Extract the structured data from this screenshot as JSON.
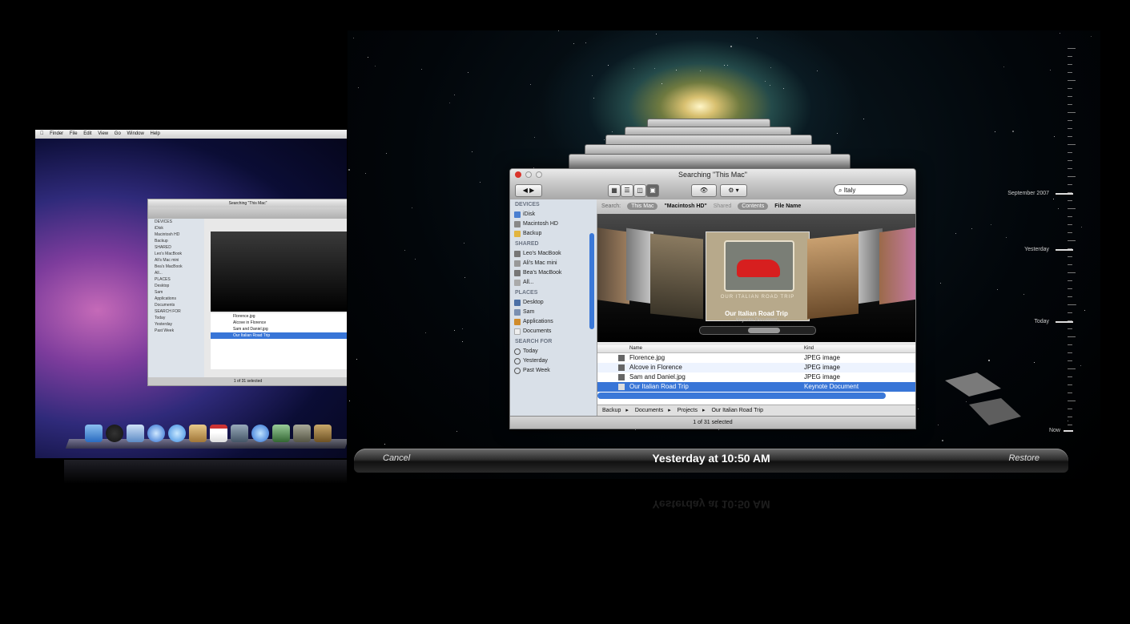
{
  "left_desktop": {
    "menubar": [
      "Finder",
      "File",
      "Edit",
      "View",
      "Go",
      "Window",
      "Help"
    ],
    "window_title": "Searching \"This Mac\"",
    "sidebar": [
      "DEVICES",
      "iDisk",
      "Macintosh HD",
      "Backup",
      "SHARED",
      "Leo's MacBook",
      "Ali's Mac mini",
      "Bea's MacBook",
      "All...",
      "PLACES",
      "Desktop",
      "Sam",
      "Applications",
      "Documents",
      "SEARCH FOR",
      "Today",
      "Yesterday",
      "Past Week"
    ],
    "files": [
      "Florence.jpg",
      "Alcove in Florence",
      "Sam and Daniel.jpg",
      "Our Italian Road Trip"
    ],
    "status": "1 of 31 selected"
  },
  "finder": {
    "title": "Searching \"This Mac\"",
    "search_value": "Italy",
    "search_bar": {
      "label": "Search:",
      "this_mac": "This Mac",
      "volume": "\"Macintosh HD\"",
      "shared": "Shared",
      "contents": "Contents",
      "file_name": "File Name"
    },
    "sidebar": {
      "devices_head": "DEVICES",
      "devices": [
        "iDisk",
        "Macintosh HD",
        "Backup"
      ],
      "shared_head": "SHARED",
      "shared": [
        "Leo's MacBook",
        "Ali's Mac mini",
        "Bea's MacBook",
        "All..."
      ],
      "places_head": "PLACES",
      "places": [
        "Desktop",
        "Sam",
        "Applications",
        "Documents"
      ],
      "search_head": "SEARCH FOR",
      "search": [
        "Today",
        "Yesterday",
        "Past Week"
      ]
    },
    "coverflow": {
      "center_caption": "OUR ITALIAN ROAD TRIP",
      "label": "Our Italian Road Trip",
      "sublabel": "Keynote Document"
    },
    "list": {
      "col_name": "Name",
      "col_kind": "Kind",
      "rows": [
        {
          "name": "Florence.jpg",
          "kind": "JPEG image"
        },
        {
          "name": "Alcove in Florence",
          "kind": "JPEG image"
        },
        {
          "name": "Sam and Daniel.jpg",
          "kind": "JPEG image"
        },
        {
          "name": "Our Italian Road Trip",
          "kind": "Keynote Document"
        }
      ]
    },
    "path": [
      "Backup",
      "Documents",
      "Projects",
      "Our Italian Road Trip"
    ],
    "status": "1 of 31 selected"
  },
  "timeline": {
    "labels": [
      "September 2007",
      "Yesterday",
      "Today",
      "Now"
    ]
  },
  "time_machine_bar": {
    "cancel": "Cancel",
    "date": "Yesterday at 10:50 AM",
    "restore": "Restore"
  },
  "colors": {
    "selection": "#3875d7",
    "sidebar": "#d9e0e8",
    "background": "#000000"
  }
}
